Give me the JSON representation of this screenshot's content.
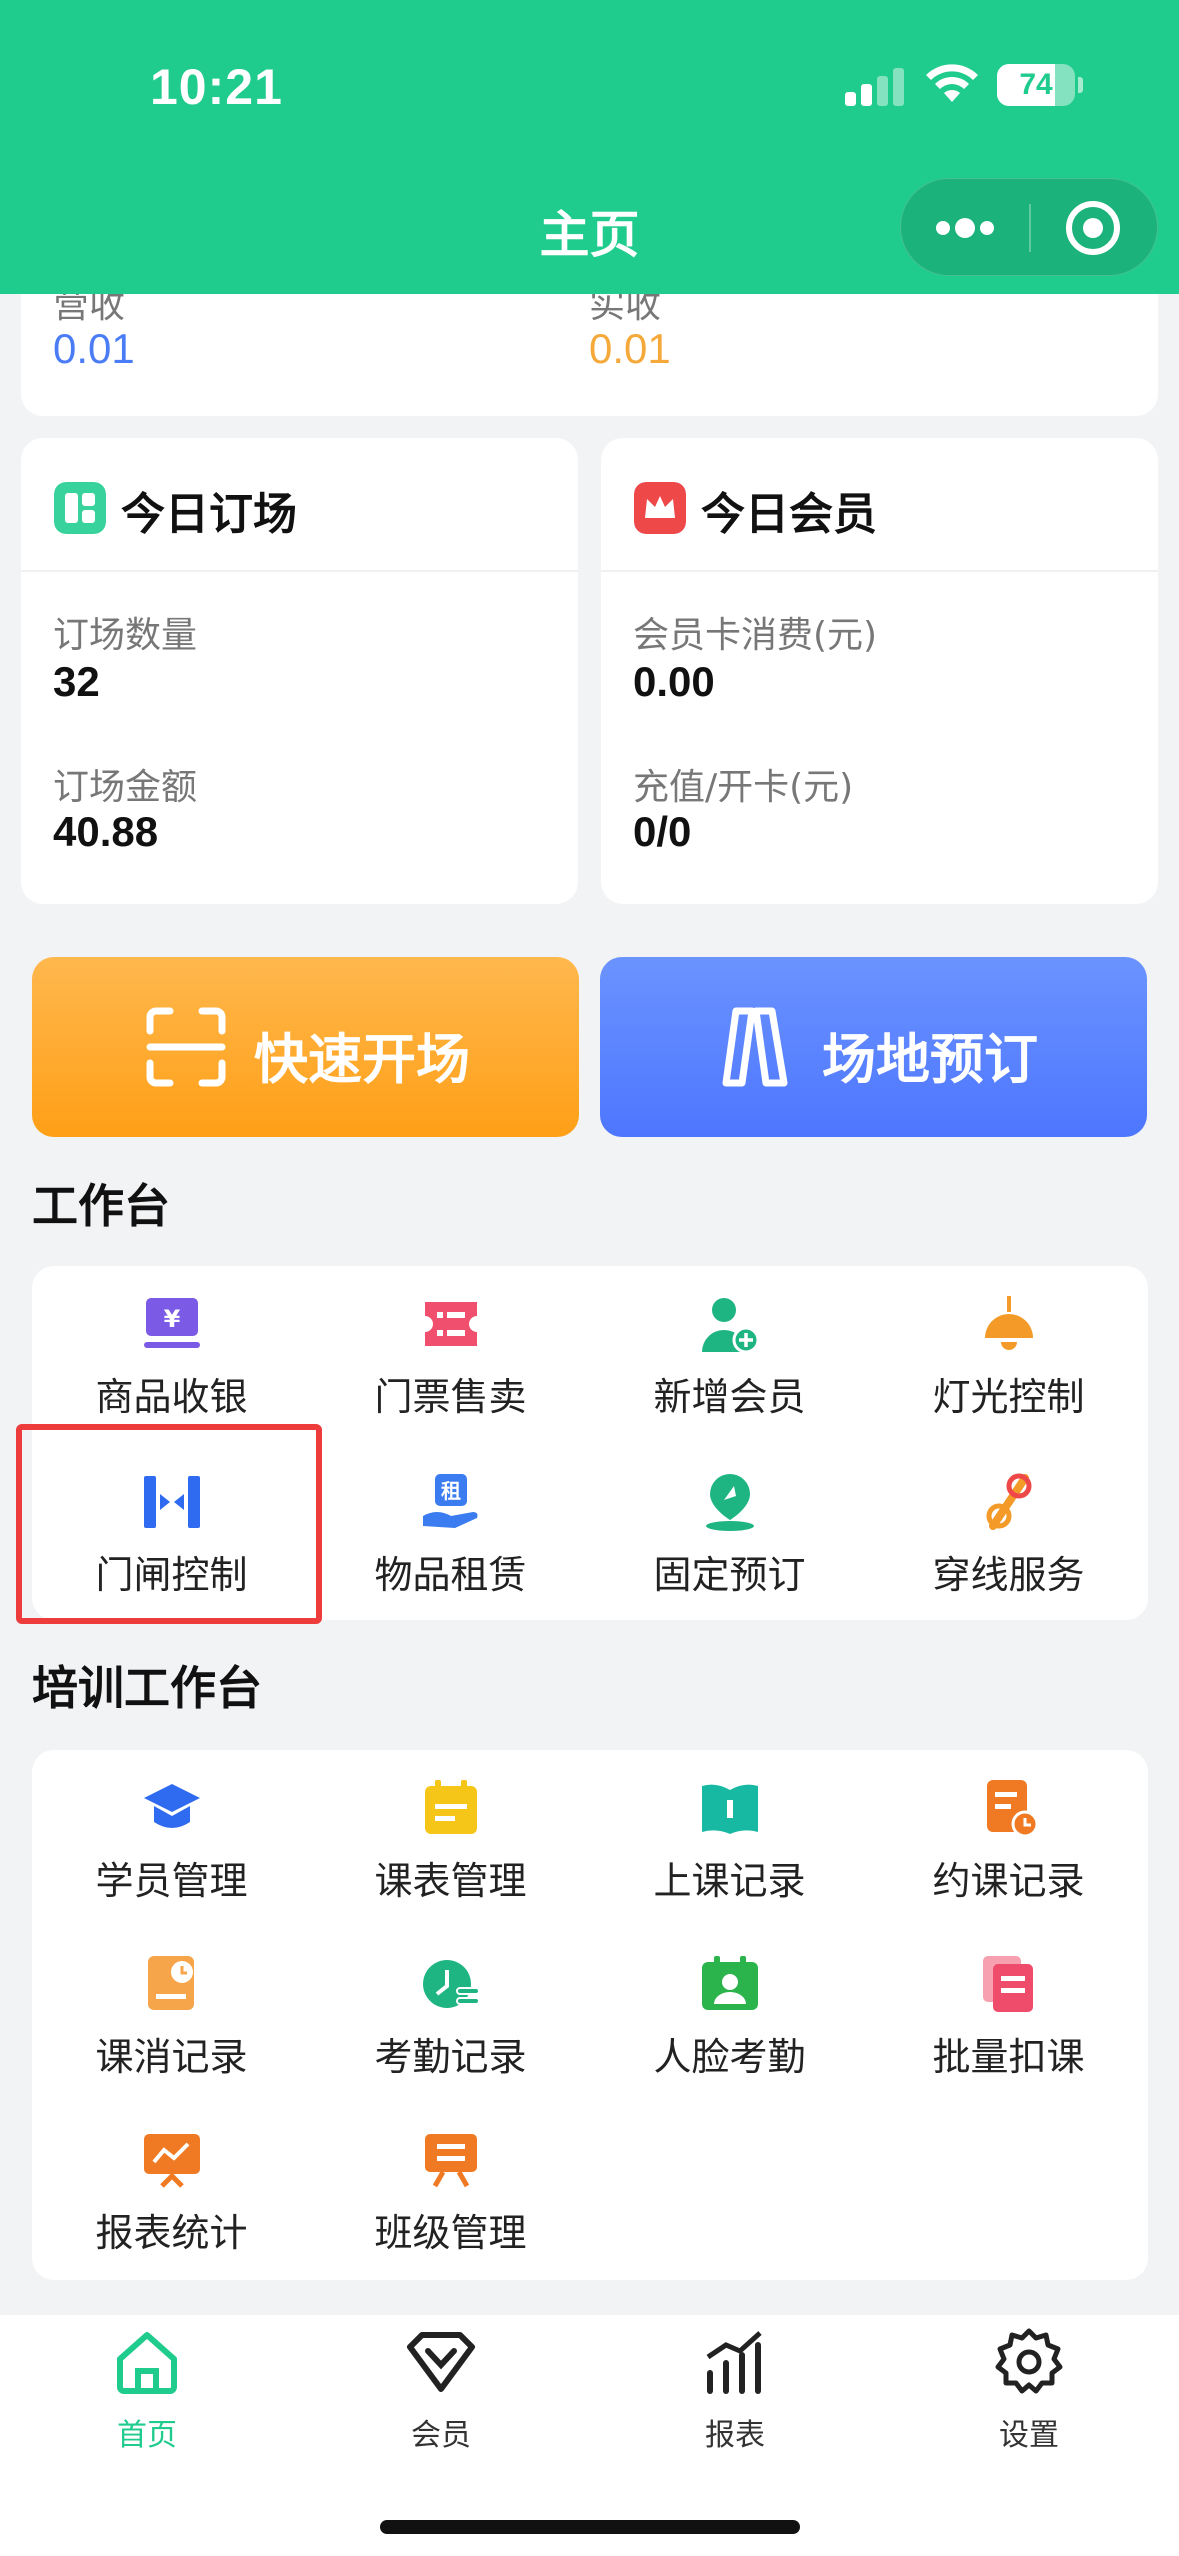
{
  "status_bar": {
    "time": "10:21",
    "battery": "74",
    "battery_level": 0.74
  },
  "nav": {
    "title": "主页"
  },
  "income": {
    "left_label": "营收",
    "left_value": "0.01",
    "right_label": "实收",
    "right_value": "0.01"
  },
  "booking_card": {
    "title": "今日订场",
    "count_label": "订场数量",
    "count_value": "32",
    "amount_label": "订场金额",
    "amount_value": "40.88"
  },
  "member_card": {
    "title": "今日会员",
    "consume_label": "会员卡消费(元)",
    "consume_value": "0.00",
    "recharge_label": "充值/开卡(元)",
    "recharge_value": "0/0"
  },
  "quick_actions": {
    "quick_open": "快速开场",
    "venue_booking": "场地预订"
  },
  "workbench": {
    "title": "工作台",
    "items": [
      {
        "label": "商品收银",
        "icon": "cashier-icon"
      },
      {
        "label": "门票售卖",
        "icon": "ticket-icon"
      },
      {
        "label": "新增会员",
        "icon": "add-member-icon"
      },
      {
        "label": "灯光控制",
        "icon": "lamp-icon"
      },
      {
        "label": "门闸控制",
        "icon": "gate-icon"
      },
      {
        "label": "物品租赁",
        "icon": "rental-icon"
      },
      {
        "label": "固定预订",
        "icon": "pin-location-icon"
      },
      {
        "label": "穿线服务",
        "icon": "stringing-icon"
      }
    ]
  },
  "training": {
    "title": "培训工作台",
    "items": [
      {
        "label": "学员管理",
        "icon": "graduation-cap-icon"
      },
      {
        "label": "课表管理",
        "icon": "calendar-icon"
      },
      {
        "label": "上课记录",
        "icon": "book-icon"
      },
      {
        "label": "约课记录",
        "icon": "appointment-icon"
      },
      {
        "label": "课消记录",
        "icon": "consume-record-icon"
      },
      {
        "label": "考勤记录",
        "icon": "attendance-icon"
      },
      {
        "label": "人脸考勤",
        "icon": "face-id-icon"
      },
      {
        "label": "批量扣课",
        "icon": "batch-deduct-icon"
      },
      {
        "label": "报表统计",
        "icon": "report-chart-icon"
      },
      {
        "label": "班级管理",
        "icon": "class-icon"
      }
    ]
  },
  "tabbar": {
    "items": [
      {
        "label": "首页",
        "icon": "home-icon"
      },
      {
        "label": "会员",
        "icon": "member-icon"
      },
      {
        "label": "报表",
        "icon": "report-icon"
      },
      {
        "label": "设置",
        "icon": "settings-icon"
      }
    ]
  },
  "colors": {
    "brand": "#1fcb8d",
    "income_left": "#4a7cf6",
    "income_right": "#f6a93b",
    "highlight": "#ee3b3b"
  }
}
